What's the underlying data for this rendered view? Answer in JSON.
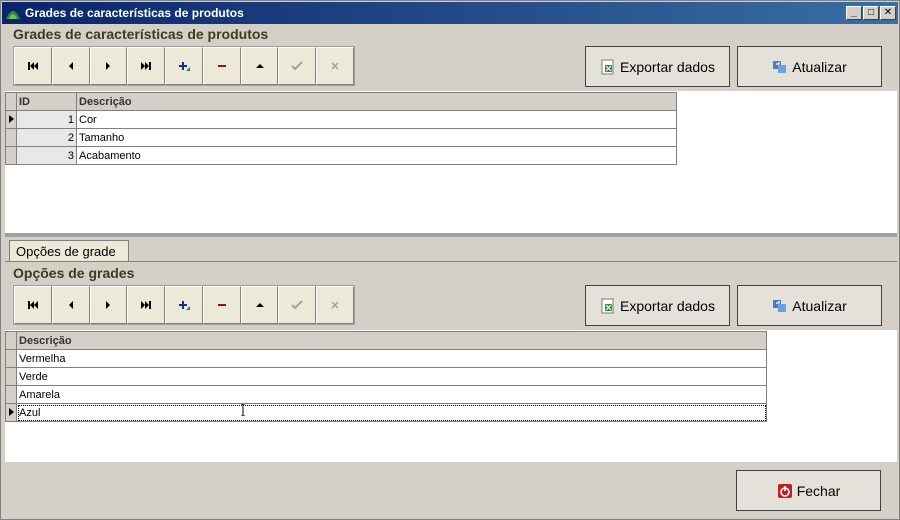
{
  "window": {
    "title": "Grades de características de produtos"
  },
  "top": {
    "section_title": "Grades de características de produtos",
    "export_label": "Exportar dados",
    "refresh_label": "Atualizar",
    "grid": {
      "headers": [
        "ID",
        "Descrição"
      ],
      "rows": [
        {
          "id": "1",
          "descricao": "Cor"
        },
        {
          "id": "2",
          "descricao": "Tamanho"
        },
        {
          "id": "3",
          "descricao": "Acabamento"
        }
      ]
    }
  },
  "bottom": {
    "tab_label": "Opções de grade",
    "section_title": "Opções de grades",
    "export_label": "Exportar dados",
    "refresh_label": "Atualizar",
    "grid": {
      "headers": [
        "Descrição"
      ],
      "rows": [
        {
          "descricao": "Vermelha"
        },
        {
          "descricao": "Verde"
        },
        {
          "descricao": "Amarela"
        },
        {
          "descricao": "Azul"
        }
      ]
    }
  },
  "footer": {
    "close_label": "Fechar"
  },
  "icons": [
    "first-record-icon",
    "prior-record-icon",
    "next-record-icon",
    "last-record-icon",
    "insert-icon",
    "delete-icon",
    "edit-icon",
    "post-icon",
    "cancel-icon",
    "excel-icon",
    "refresh-icon",
    "power-icon"
  ],
  "colors": {
    "title_bar": "#0a246a",
    "section_title": "#3c3c1e",
    "delete": "#a01010",
    "insert": "#1030a0"
  }
}
